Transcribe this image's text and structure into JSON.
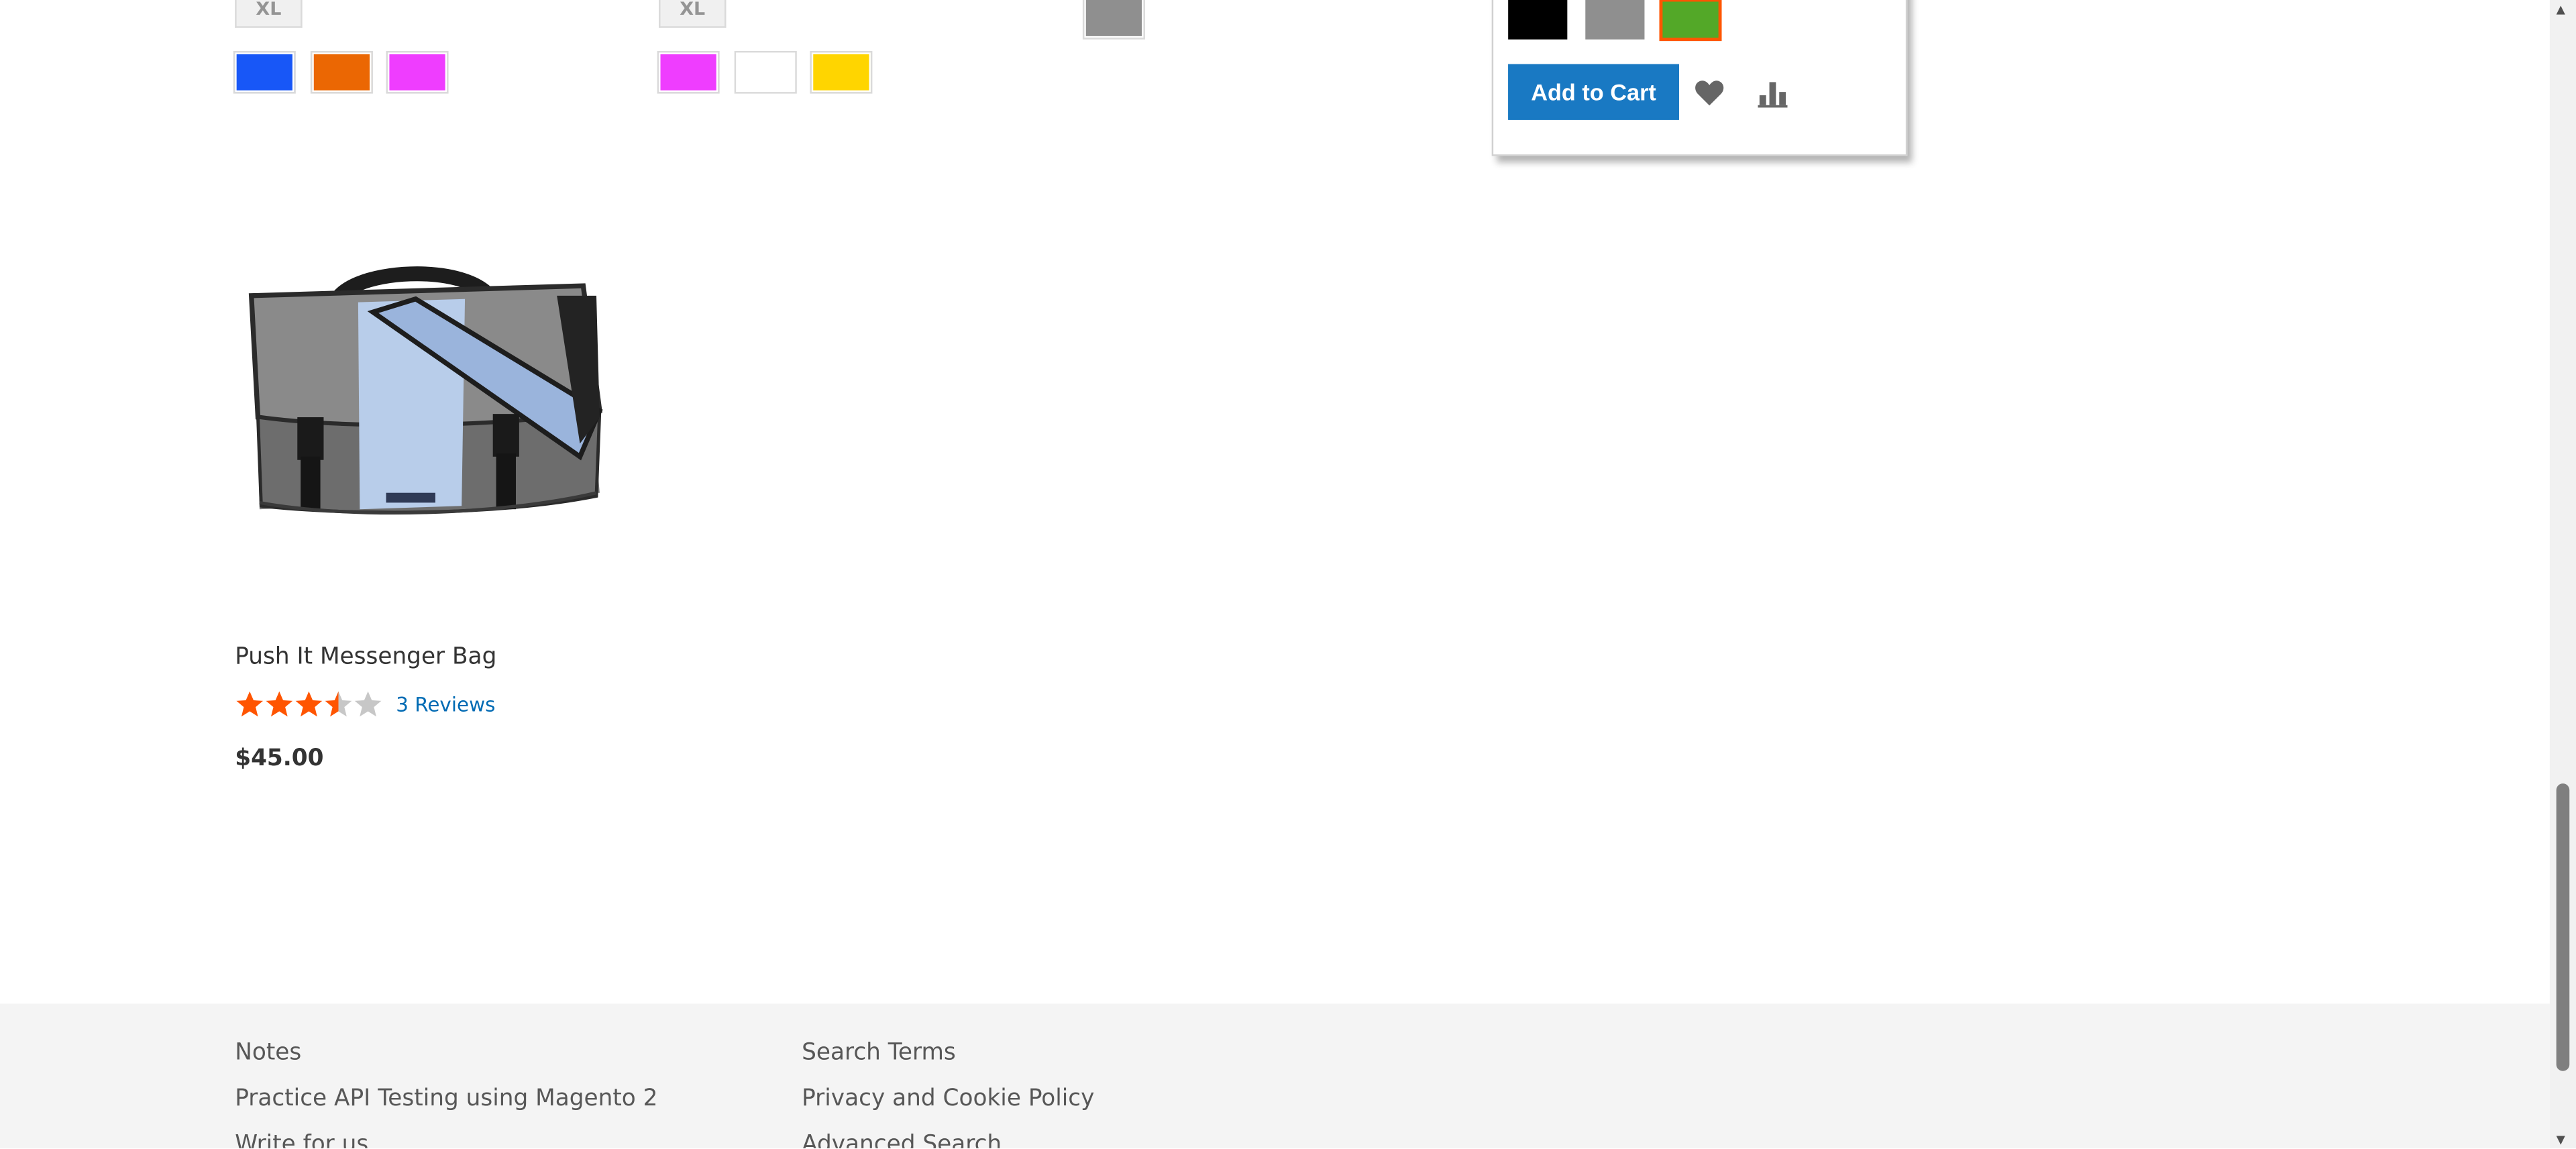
{
  "top_row": {
    "product_1": {
      "size_label": "XL",
      "swatches": [
        {
          "name": "blue",
          "color": "#1857f7"
        },
        {
          "name": "orange",
          "color": "#eb6703"
        },
        {
          "name": "purple",
          "color": "#ef3dff"
        }
      ]
    },
    "product_2": {
      "size_label": "XL",
      "swatches": [
        {
          "name": "purple",
          "color": "#ef3dff"
        },
        {
          "name": "white",
          "color": "#ffffff"
        },
        {
          "name": "yellow",
          "color": "#ffd500"
        }
      ]
    },
    "product_3": {
      "swatches": [
        {
          "name": "gray",
          "color": "#8f8f8f"
        }
      ]
    },
    "hover_card": {
      "swatches": [
        {
          "name": "black",
          "color": "#000000"
        },
        {
          "name": "gray",
          "color": "#8f8f8f"
        },
        {
          "name": "green",
          "color": "#53a828",
          "selected": true,
          "selected_outline": "#ff5501"
        }
      ],
      "add_to_cart_label": "Add to Cart",
      "wishlist_icon": "heart-icon",
      "compare_icon": "compare-bars-icon"
    }
  },
  "product": {
    "name": "Push It Messenger Bag",
    "rating_stars": 3.5,
    "rating_max": 5,
    "reviews_label": "3 Reviews",
    "price": "$45.00",
    "image": "messenger-bag-image"
  },
  "footer": {
    "col_1": [
      "Notes",
      "Practice API Testing using Magento 2",
      "Write for us"
    ],
    "col_2": [
      "Search Terms",
      "Privacy and Cookie Policy",
      "Advanced Search"
    ]
  },
  "colors": {
    "accent": "#1979c3",
    "link": "#006bb4",
    "star": "#ff5501"
  }
}
